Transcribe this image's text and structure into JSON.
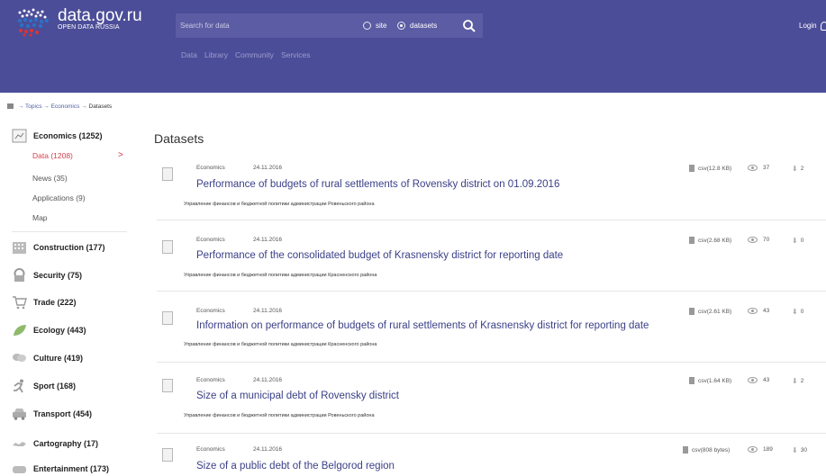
{
  "header": {
    "site_name": "data.gov.ru",
    "site_sub": "OPEN DATA RUSSIA",
    "search_placeholder": "Search for data",
    "radio_site": "site",
    "radio_datasets": "datasets",
    "nav": [
      "Data",
      "Library",
      "Community",
      "Services"
    ],
    "login": "Login",
    "colors": {
      "bar": "#4c4d98",
      "search": "#5b5ca4",
      "nav": "#9c9cd0"
    }
  },
  "breadcrumb": {
    "topics": "Topics",
    "economics": "Economics",
    "current": "Datasets",
    "sep": "→"
  },
  "sidebar": {
    "categories": [
      {
        "label": "Economics (1252)",
        "icon": "document-chart-icon"
      },
      {
        "label": "Construction (177)",
        "icon": "building-icon"
      },
      {
        "label": "Security (75)",
        "icon": "shield-lock-icon"
      },
      {
        "label": "Trade (222)",
        "icon": "shopping-cart-icon"
      },
      {
        "label": "Ecology (443)",
        "icon": "leaf-icon"
      },
      {
        "label": "Culture (419)",
        "icon": "theatre-icon"
      },
      {
        "label": "Sport (168)",
        "icon": "runner-icon"
      },
      {
        "label": "Transport (454)",
        "icon": "car-icon"
      },
      {
        "label": "Cartography (17)",
        "icon": "map-icon"
      },
      {
        "label": "Entertainment (173)",
        "icon": "entertainment-icon"
      }
    ],
    "subitems": [
      "Data (1208)",
      "News (35)",
      "Applications (9)",
      "Map"
    ],
    "active_arrow": ">",
    "active_color": "#d6404a"
  },
  "main": {
    "title": "Datasets",
    "datasets": [
      {
        "category": "Economics",
        "date": "24.11.2016",
        "title": "Performance of budgets of rural settlements of Rovensky district on 01.09.2016",
        "org": "Управление финансов и бюджетной политики администрации Ровеньского района",
        "format": "csv(12.8 KB)",
        "views": "37",
        "downloads": "2"
      },
      {
        "category": "Economics",
        "date": "24.11.2016",
        "title": "Performance of the consolidated budget of Krasnensky district for reporting date",
        "org": "Управление финансов и бюджетной политики администрации Красненского района",
        "format": "csv(2.68 KB)",
        "views": "70",
        "downloads": "0"
      },
      {
        "category": "Economics",
        "date": "24.11.2016",
        "title": "Information on performance of budgets of rural settlements of Krasnensky district for reporting date",
        "org": "Управление финансов и бюджетной политики администрации Красненского района",
        "format": "csv(2.61 KB)",
        "views": "43",
        "downloads": "0"
      },
      {
        "category": "Economics",
        "date": "24.11.2016",
        "title": "Size of a municipal debt of Rovensky district",
        "org": "Управление финансов и бюджетной политики администрации Ровеньского района",
        "format": "csv(1.64 KB)",
        "views": "43",
        "downloads": "2"
      },
      {
        "category": "Economics",
        "date": "24.11.2016",
        "title": "Size of a public debt of the Belgorod region",
        "org": "",
        "format": "csv(808 bytes)",
        "views": "189",
        "downloads": "30"
      }
    ],
    "title_color": "#3a3f87"
  }
}
